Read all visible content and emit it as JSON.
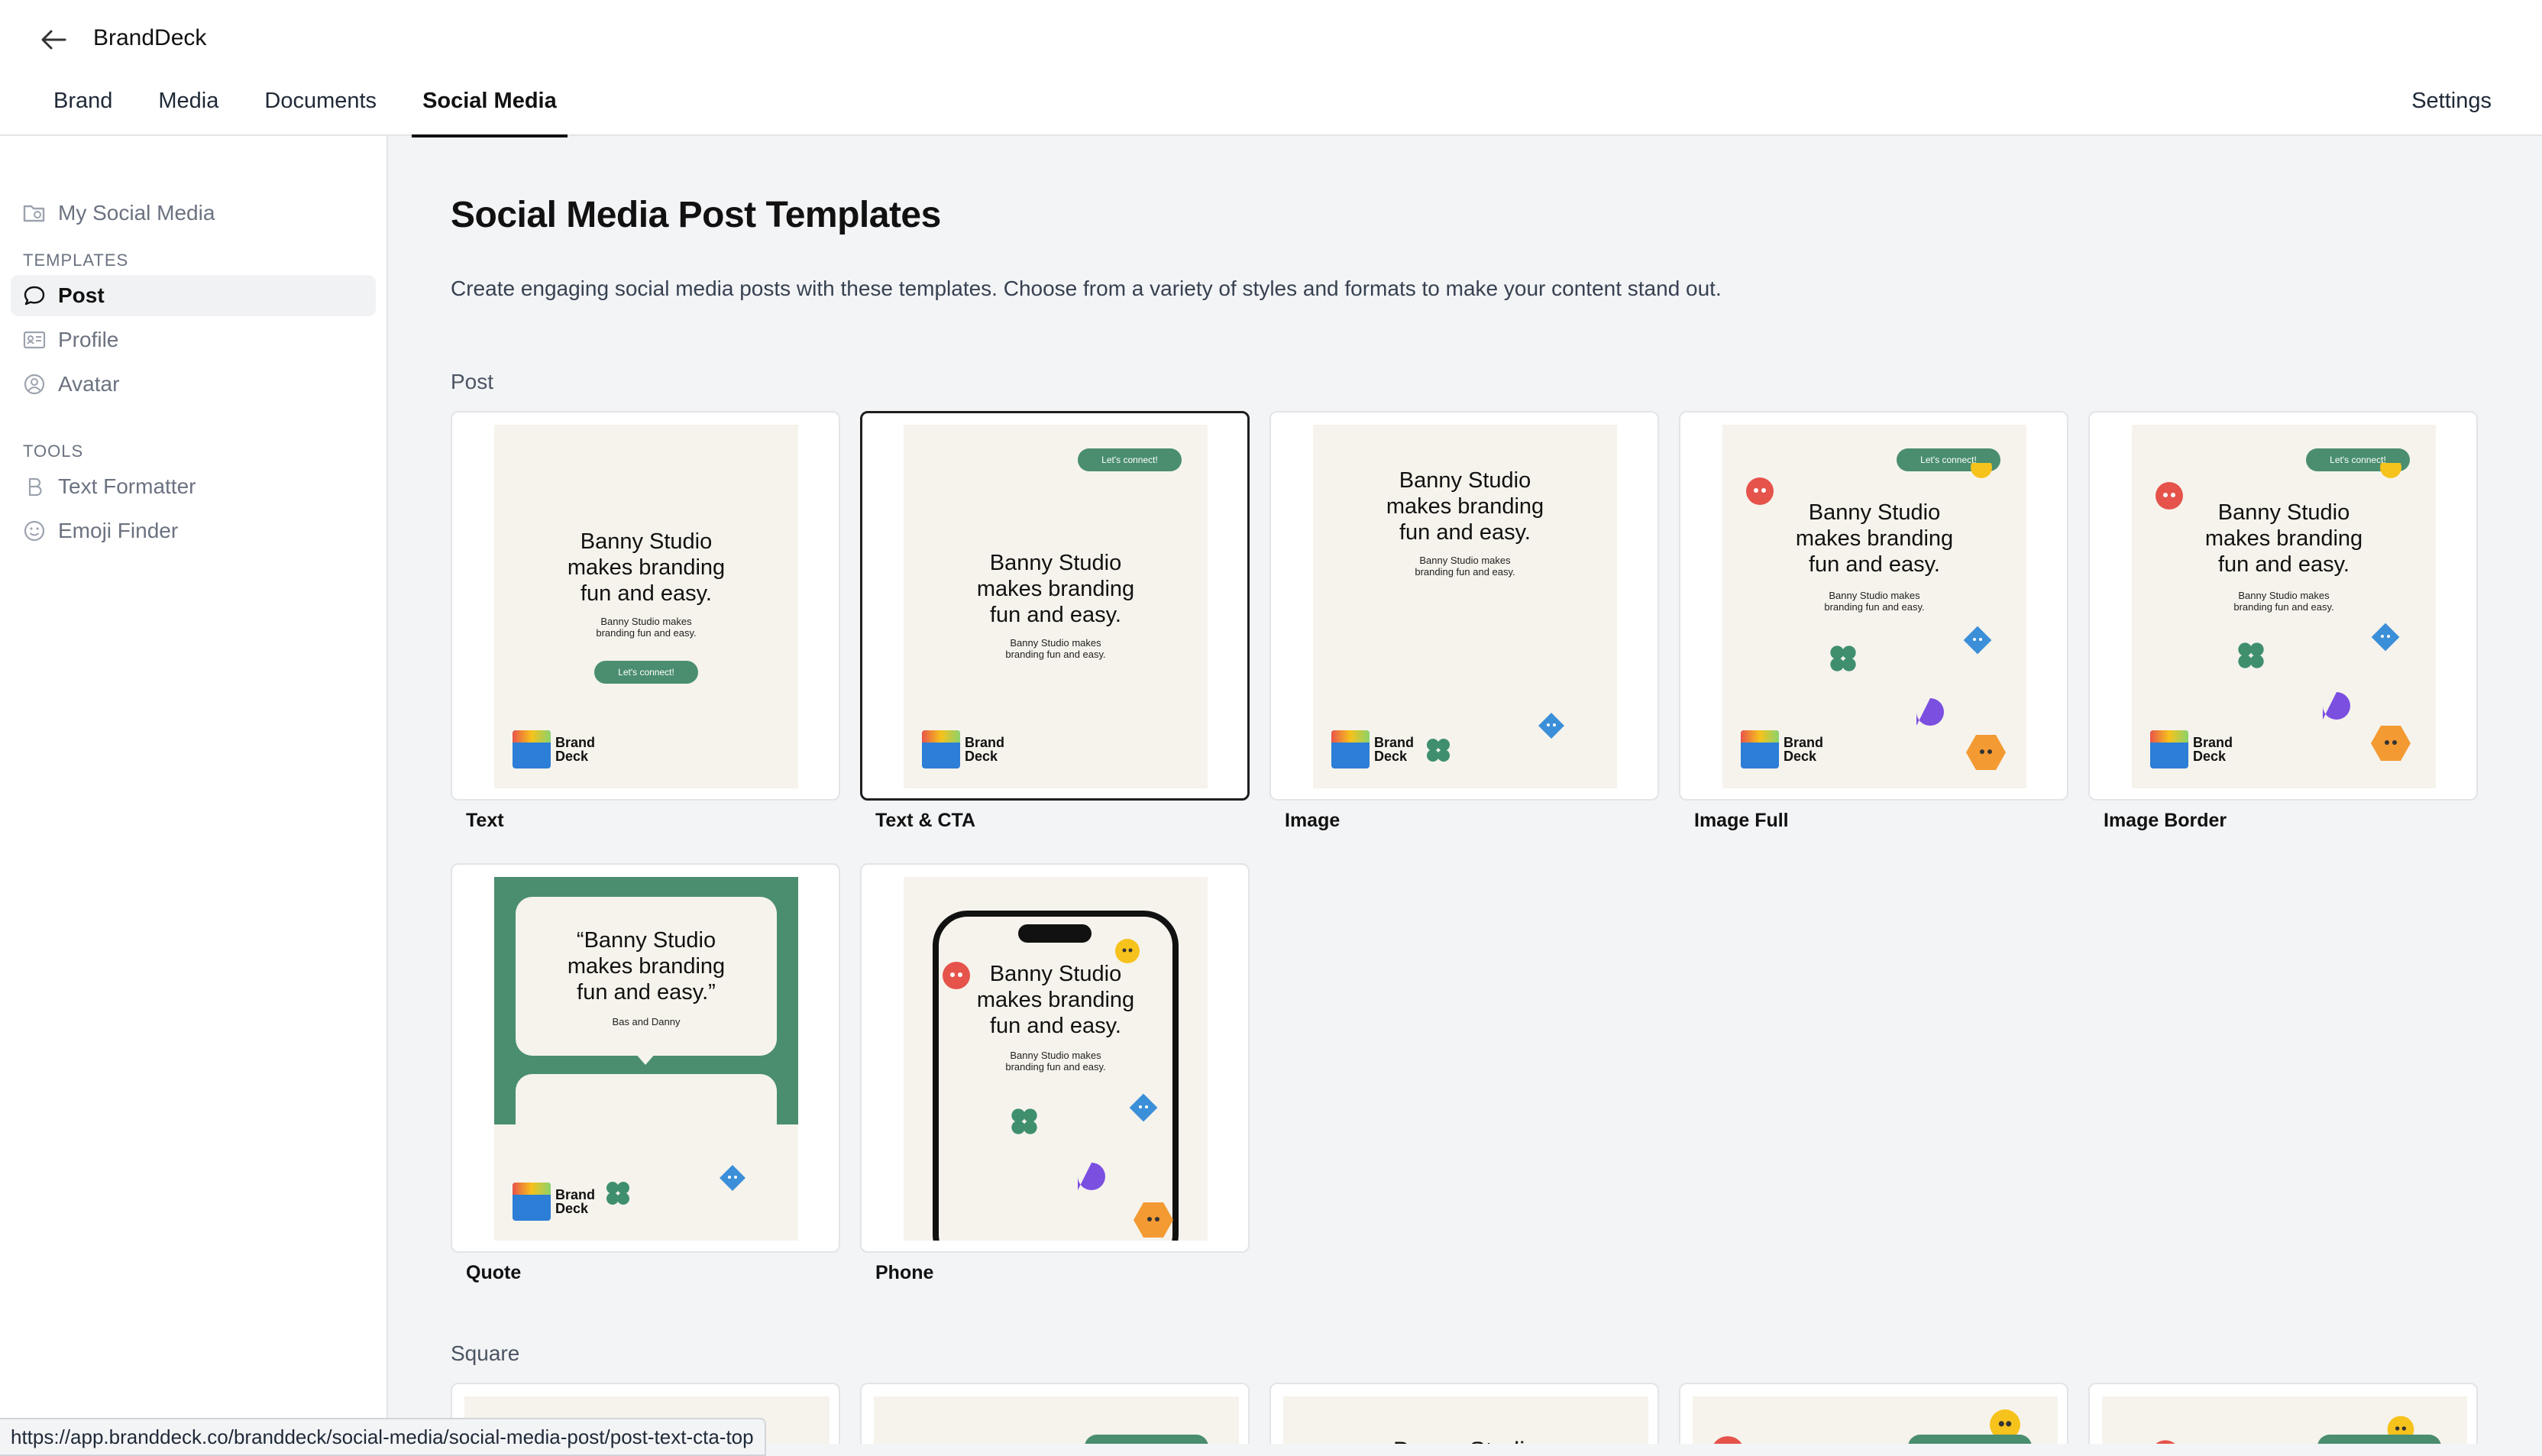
{
  "app": {
    "title": "BrandDeck"
  },
  "tabs": [
    {
      "label": "Brand",
      "active": false
    },
    {
      "label": "Media",
      "active": false
    },
    {
      "label": "Documents",
      "active": false
    },
    {
      "label": "Social Media",
      "active": true
    }
  ],
  "settings_label": "Settings",
  "sidebar": {
    "top_item": {
      "label": "My Social Media",
      "icon": "folder-icon"
    },
    "sections": [
      {
        "title": "TEMPLATES",
        "items": [
          {
            "label": "Post",
            "icon": "chat-bubble-icon",
            "active": true
          },
          {
            "label": "Profile",
            "icon": "id-card-icon",
            "active": false
          },
          {
            "label": "Avatar",
            "icon": "user-circle-icon",
            "active": false
          }
        ]
      },
      {
        "title": "TOOLS",
        "items": [
          {
            "label": "Text Formatter",
            "icon": "bold-b-icon",
            "active": false
          },
          {
            "label": "Emoji Finder",
            "icon": "smiley-icon",
            "active": false
          }
        ]
      }
    ]
  },
  "main": {
    "title": "Social Media Post Templates",
    "description": "Create engaging social media posts with these templates. Choose from a variety of styles and formats to make your content stand out.",
    "sections": [
      {
        "label": "Post",
        "templates": [
          "Text",
          "Text & CTA",
          "Image",
          "Image Full",
          "Image Border",
          "Quote",
          "Phone"
        ]
      },
      {
        "label": "Square"
      }
    ],
    "thumb": {
      "headline": "Banny Studio makes branding fun and easy.",
      "headline_line1": "Banny Studio",
      "headline_line2": "makes branding",
      "headline_line3": "fun and easy.",
      "sub_line1": "Banny Studio makes",
      "sub_line2": "branding fun and easy.",
      "cta": "Let's connect!",
      "logo_line1": "Brand",
      "logo_line2": "Deck",
      "quote_line1": "“Banny Studio",
      "quote_line2": "makes branding",
      "quote_line3": "fun and easy.”",
      "quote_author": "Bas and Danny"
    },
    "square_thumb_headline": "Banny Studio"
  },
  "status_bar": {
    "url": "https://app.branddeck.co/branddeck/social-media/social-media-post/post-text-cta-top"
  },
  "colors": {
    "green": "#4a8e6f",
    "cream": "#f6f3ec",
    "red": "#e5534b",
    "blue": "#3b8fd8",
    "purple": "#7b4fe0",
    "orange": "#f39a33",
    "yellow": "#f6c21c"
  }
}
